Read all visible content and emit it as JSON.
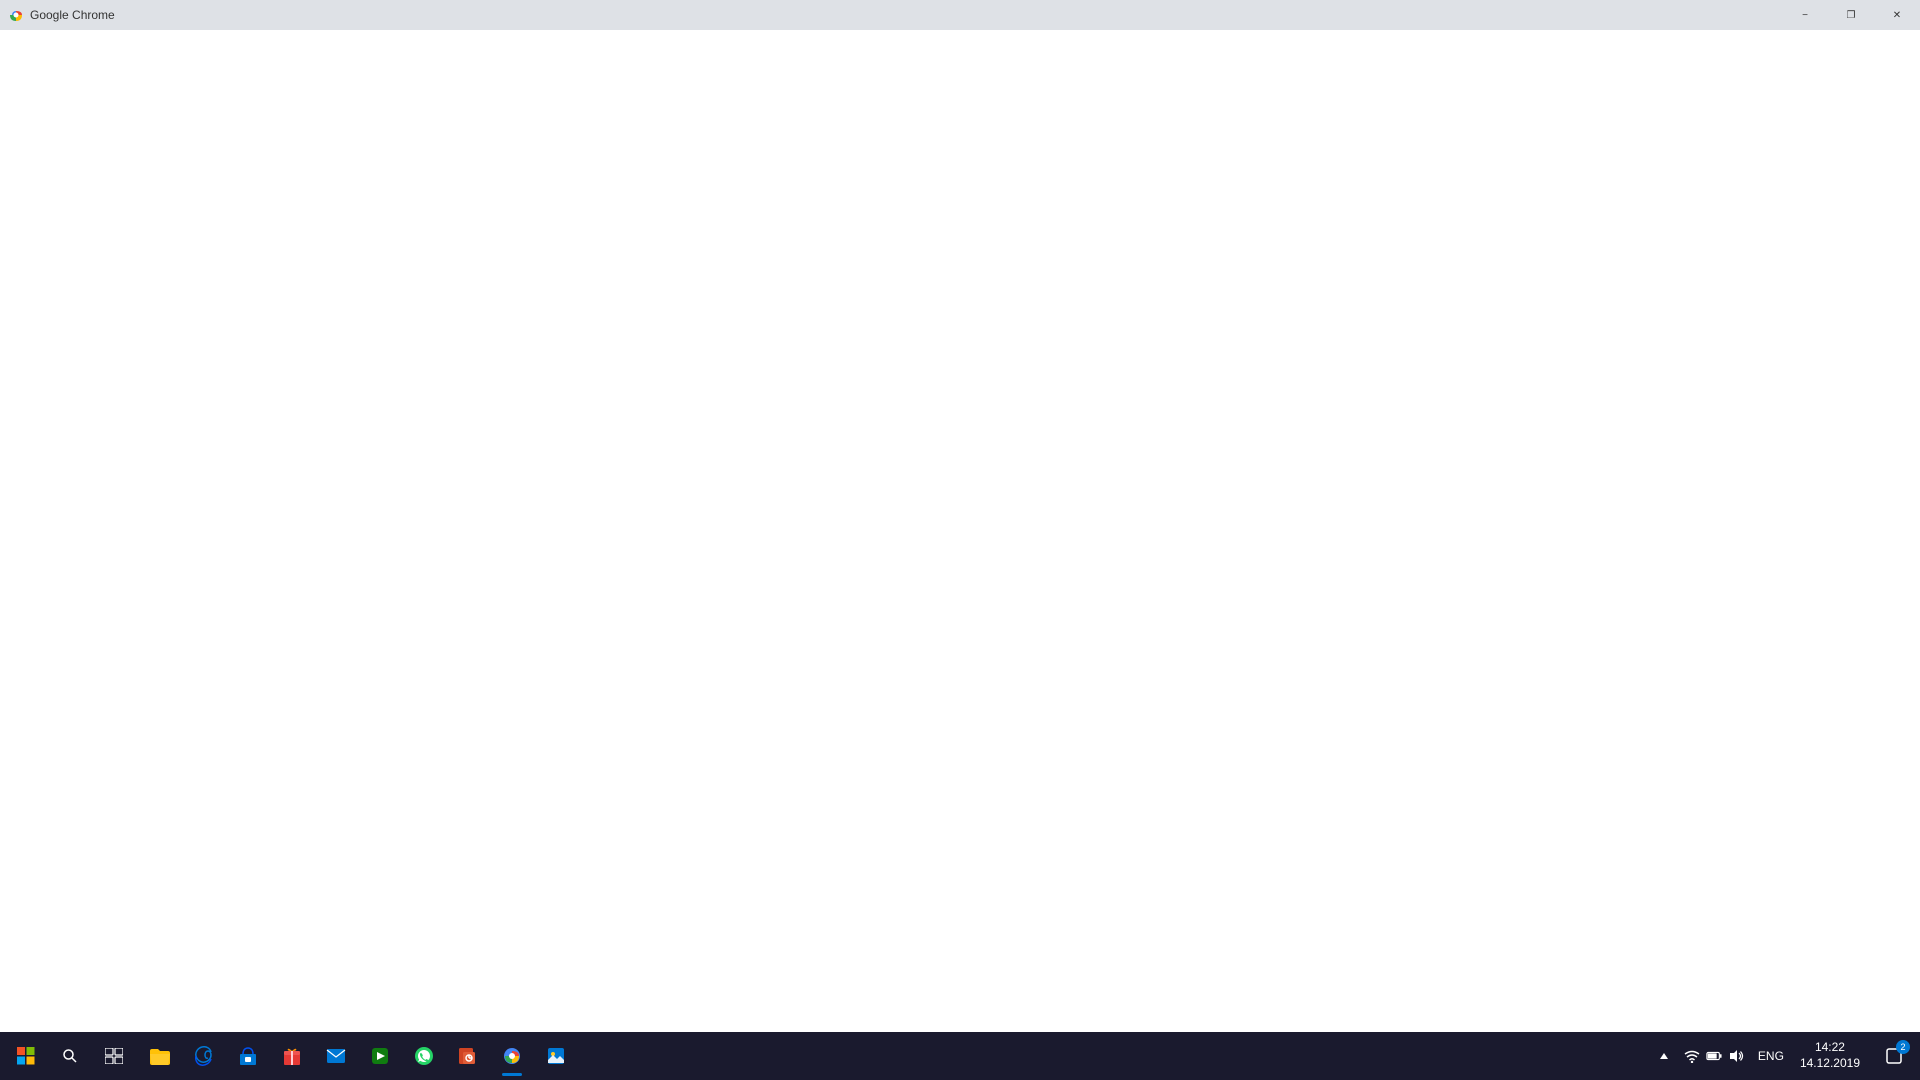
{
  "titlebar": {
    "title": "Google Chrome",
    "minimize_label": "−",
    "restore_label": "❐",
    "close_label": "✕"
  },
  "taskbar": {
    "search_placeholder": "Search",
    "tray": {
      "time": "14:22",
      "date": "14.12.2019",
      "language": "ENG",
      "notification_count": "2"
    },
    "apps": [
      {
        "name": "start",
        "label": "Start"
      },
      {
        "name": "search",
        "label": "Search"
      },
      {
        "name": "task-view",
        "label": "Task View"
      },
      {
        "name": "file-explorer",
        "label": "File Explorer"
      },
      {
        "name": "edge",
        "label": "Microsoft Edge"
      },
      {
        "name": "store",
        "label": "Microsoft Store"
      },
      {
        "name": "gift",
        "label": "Gift"
      },
      {
        "name": "mail",
        "label": "Mail"
      },
      {
        "name": "media",
        "label": "Media"
      },
      {
        "name": "whatsapp",
        "label": "WhatsApp"
      },
      {
        "name": "powerpoint",
        "label": "PowerPoint"
      },
      {
        "name": "chrome",
        "label": "Google Chrome"
      },
      {
        "name": "photos",
        "label": "Photos"
      }
    ]
  }
}
